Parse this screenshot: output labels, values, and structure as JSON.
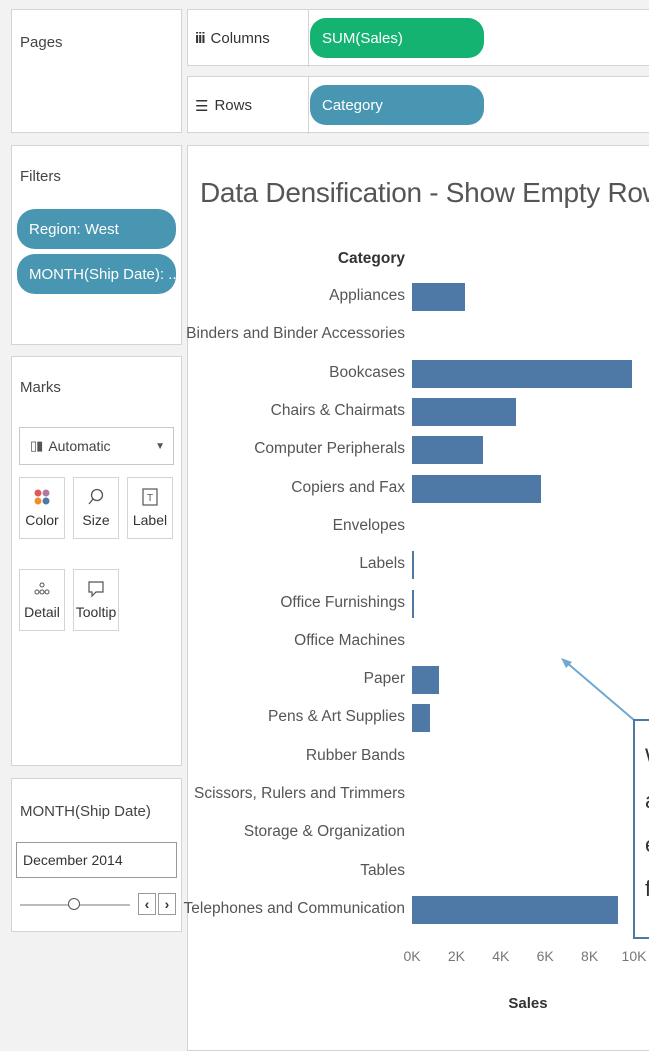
{
  "pages": {
    "title": "Pages"
  },
  "shelves": {
    "columns_label": "Columns",
    "columns_pill": "SUM(Sales)",
    "rows_label": "Rows",
    "rows_pill": "Category"
  },
  "filters": {
    "title": "Filters",
    "items": [
      "Region: West",
      "MONTH(Ship Date): .."
    ]
  },
  "marks": {
    "title": "Marks",
    "type_select": "Automatic",
    "buttons": [
      "Color",
      "Size",
      "Label",
      "Detail",
      "Tooltip"
    ]
  },
  "month_card": {
    "title": "MONTH(Ship Date)",
    "value": "December 2014"
  },
  "view": {
    "title": "Data Densification - Show Empty Rows",
    "row_header": "Category",
    "annotation_lines": [
      "W",
      "a",
      "e",
      "f"
    ]
  },
  "chart_data": {
    "type": "bar",
    "orientation": "horizontal",
    "categories": [
      "Appliances",
      "Binders and Binder Accessories",
      "Bookcases",
      "Chairs & Chairmats",
      "Computer Peripherals",
      "Copiers and Fax",
      "Envelopes",
      "Labels",
      "Office Furnishings",
      "Office Machines",
      "Paper",
      "Pens & Art Supplies",
      "Rubber Bands",
      "Scissors, Rulers and Trimmers",
      "Storage & Organization",
      "Tables",
      "Telephones and Communication"
    ],
    "values": [
      2400,
      0,
      9900,
      4700,
      3200,
      5800,
      0,
      60,
      110,
      0,
      1200,
      800,
      0,
      0,
      0,
      0,
      9300
    ],
    "xlabel": "Sales",
    "xlim": [
      0,
      10000
    ],
    "ticks": [
      {
        "value": 0,
        "label": "0K"
      },
      {
        "value": 2000,
        "label": "2K"
      },
      {
        "value": 4000,
        "label": "4K"
      },
      {
        "value": 6000,
        "label": "6K"
      },
      {
        "value": 8000,
        "label": "8K"
      },
      {
        "value": 10000,
        "label": "10K"
      }
    ],
    "bar_color": "#4e79a7",
    "grid": false
  }
}
